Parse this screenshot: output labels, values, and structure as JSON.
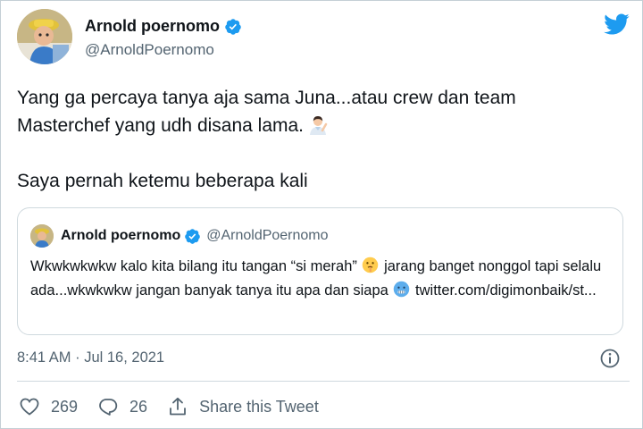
{
  "author": {
    "display_name": "Arnold poernomo",
    "handle": "@ArnoldPoernomo",
    "avatar_icon": "profile-photo",
    "verified_icon": "verified-badge-icon"
  },
  "brand": {
    "icon": "twitter-bird-icon",
    "color": "#1d9bf0"
  },
  "tweet": {
    "line1": "Yang ga percaya tanya aja sama Juna...atau crew dan team",
    "line2": "Masterchef yang udh disana lama.",
    "line2_emoji": "man-raising-hand-emoji",
    "paragraph2": "Saya pernah ketemu beberapa kali"
  },
  "quoted": {
    "display_name": "Arnold poernomo",
    "handle": "@ArnoldPoernomo",
    "text_part1": "Wkwkwkwkw kalo kita bilang itu tangan “si merah”",
    "emoji1": "shushing-face-emoji",
    "text_part2": "jarang banget nonggol tapi selalu ada...wkwkwkw jangan banyak tanya itu apa dan siapa",
    "emoji2": "cold-face-emoji",
    "link": "twitter.com/digimonbaik/st..."
  },
  "meta": {
    "timestamp": "8:41 AM · Jul 16, 2021",
    "info_icon": "info-icon"
  },
  "actions": {
    "like_count": "269",
    "reply_count": "26",
    "share_label": "Share this Tweet"
  },
  "colors": {
    "text": "#0f1419",
    "secondary": "#536471",
    "border": "#cfd9de",
    "accent": "#1d9bf0"
  }
}
